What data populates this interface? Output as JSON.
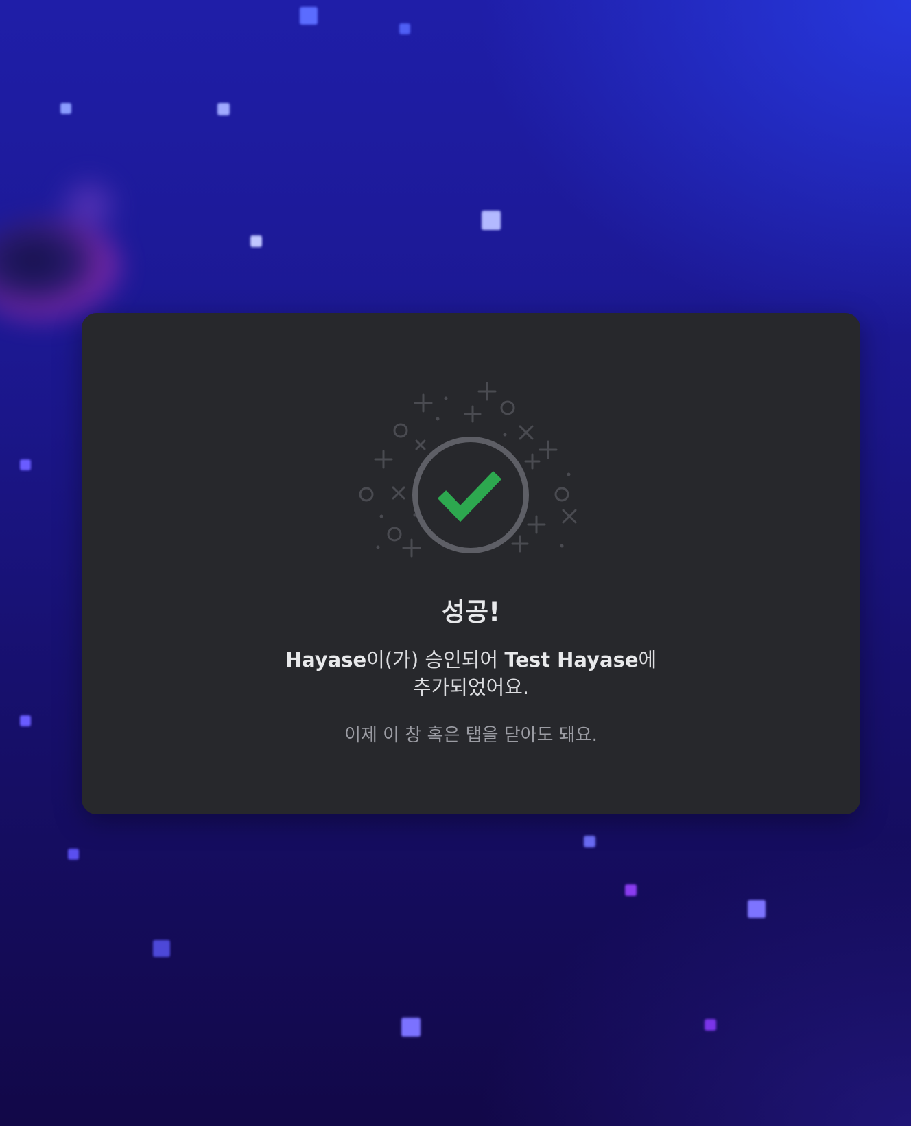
{
  "dialog": {
    "title": "성공!",
    "message": {
      "app_name": "Hayase",
      "part1": "이(가) 승인되어 ",
      "server_name": "Test Hayase",
      "part2": "에 추가되었어요."
    },
    "hint": "이제 이 창 혹은 탭을 닫아도 돼요.",
    "icon": "checkmark-circle-icon"
  },
  "colors": {
    "background_top": "#1f1ea8",
    "background_bottom": "#120848",
    "card": "#27282c",
    "check": "#2da84f",
    "ring": "#5e5f66",
    "title_text": "#e8e9eb",
    "hint_text": "#9b9ca3"
  }
}
